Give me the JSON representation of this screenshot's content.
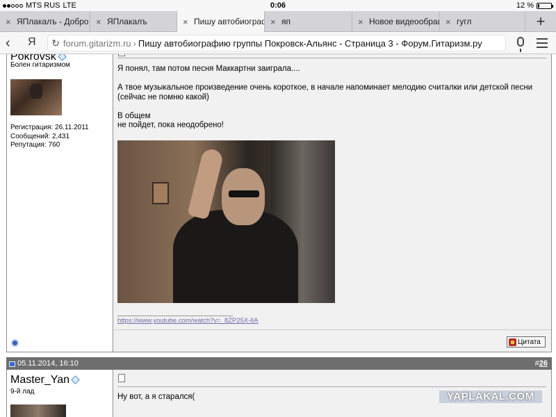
{
  "status_bar": {
    "carrier": "MTS RUS",
    "network": "LTE",
    "time": "0:06",
    "battery_percent": "12 %",
    "battery_level": 0.12
  },
  "tabs": [
    {
      "label": "ЯПлакалъ - Добро",
      "active": false
    },
    {
      "label": "ЯПлакалъ",
      "active": false
    },
    {
      "label": "Пишу автобиографию",
      "active": true
    },
    {
      "label": "яп",
      "active": false
    },
    {
      "label": "Новое видеообращ",
      "active": false
    },
    {
      "label": "гугл",
      "active": false
    }
  ],
  "tab_add_icon": "+",
  "address": {
    "back_icon": "‹",
    "yandex_logo": "Я",
    "domain": "forum.gitarizm.ru",
    "separator": "›",
    "page_title": "Пишу автобиографию группы Покровск-Альянс - Страница 3 - Форум.Гитаризм.ру"
  },
  "post1": {
    "username": "Pokrovsk",
    "user_title": "Болен гитаризмом",
    "registration": "Регистрация: 26.11.2011",
    "messages": "Сообщений: 2,431",
    "reputation": "Репутация: 760",
    "body_lines": [
      "Я понял, там потом песня Маккартни заиграла....",
      "А твое музыкальное произведение очень короткое, в начале напоминает мелодию считалки или детской песни (сейчас не помню какой)",
      "В общем",
      "не пойдет, пока неодобрено!"
    ],
    "link": "https://www.youtube.com/watch?v=_8ZP25X-lIA",
    "quote_label": "Цитата"
  },
  "post2": {
    "date": "05.11.2014, 16:10",
    "number_prefix": "#",
    "number": "26",
    "username": "Master_Yan",
    "user_title": "9-й лад",
    "body": "Ну вот, а я старался("
  },
  "watermark": "YAPLAKAL.COM"
}
